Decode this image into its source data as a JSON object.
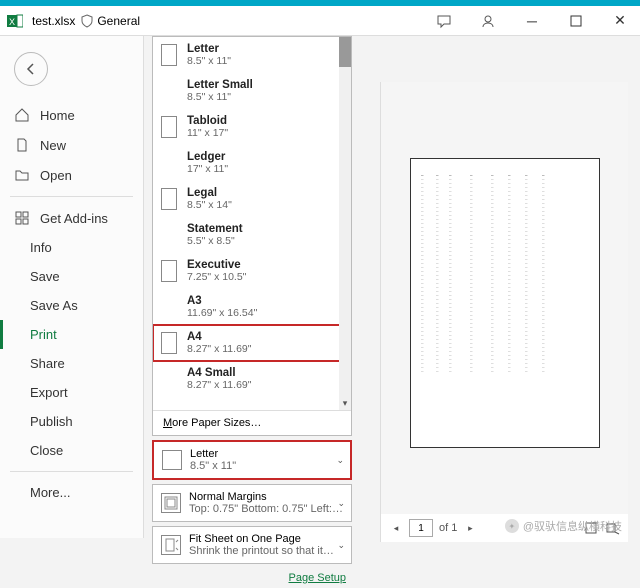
{
  "titlebar": {
    "filename": "test.xlsx",
    "sensitivity": "General"
  },
  "sidebar": {
    "home": "Home",
    "new": "New",
    "open": "Open",
    "get_addins": "Get Add-ins",
    "info": "Info",
    "save": "Save",
    "save_as": "Save As",
    "print": "Print",
    "share": "Share",
    "export": "Export",
    "publish": "Publish",
    "close": "Close",
    "more": "More..."
  },
  "paper_sizes": [
    {
      "label": "Letter",
      "dim": "8.5\" x 11\"",
      "icon": true,
      "highlight": false
    },
    {
      "label": "Letter Small",
      "dim": "8.5\" x 11\"",
      "icon": false,
      "highlight": false
    },
    {
      "label": "Tabloid",
      "dim": "11\" x 17\"",
      "icon": true,
      "highlight": false
    },
    {
      "label": "Ledger",
      "dim": "17\" x 11\"",
      "icon": false,
      "highlight": false
    },
    {
      "label": "Legal",
      "dim": "8.5\" x 14\"",
      "icon": true,
      "highlight": false
    },
    {
      "label": "Statement",
      "dim": "5.5\" x 8.5\"",
      "icon": false,
      "highlight": false
    },
    {
      "label": "Executive",
      "dim": "7.25\" x 10.5\"",
      "icon": true,
      "highlight": false
    },
    {
      "label": "A3",
      "dim": "11.69\" x 16.54\"",
      "icon": false,
      "highlight": false
    },
    {
      "label": "A4",
      "dim": "8.27\" x 11.69\"",
      "icon": true,
      "highlight": true
    },
    {
      "label": "A4 Small",
      "dim": "8.27\" x 11.69\"",
      "icon": false,
      "highlight": false
    }
  ],
  "more_sizes": "More Paper Sizes…",
  "settings": {
    "paper": {
      "label": "Letter",
      "sub": "8.5\" x 11\""
    },
    "margins": {
      "label": "Normal Margins",
      "sub": "Top: 0.75\" Bottom: 0.75\" Left:…"
    },
    "scaling": {
      "label": "Fit Sheet on One Page",
      "sub": "Shrink the printout so that it…"
    },
    "page_setup": "Page Setup"
  },
  "preview": {
    "page_current": "1",
    "page_of": "of 1"
  },
  "watermark": "@驭驮信息纵横科技"
}
